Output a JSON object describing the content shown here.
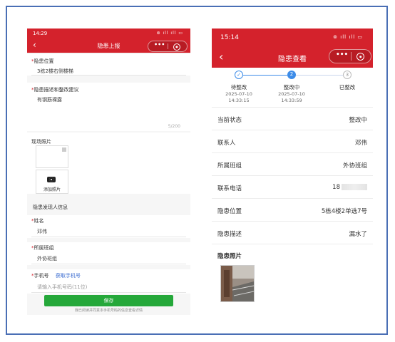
{
  "left": {
    "status_time": "14:29",
    "nav_title": "隐患上报",
    "location_label": "隐患位置",
    "location_value": "3栋2楼右侧楼梯",
    "desc_label": "隐患描述和整改建议",
    "desc_value": "有钢筋裸露",
    "desc_counter": "5/200",
    "photos_label": "现场照片",
    "add_photo": "添加照片",
    "finder_info": "隐患发现人信息",
    "name_label": "姓名",
    "name_value": "邓伟",
    "team_label": "所属班组",
    "team_value": "外协班组",
    "phone_label": "手机号",
    "get_phone": "获取手机号",
    "phone_placeholder": "请输入手机号码(11位)",
    "save_label": "保存",
    "notice_text": "我已阅读并同意本手机号码的信息查看详情",
    "notice_link": "查看详情"
  },
  "right": {
    "status_time": "15:14",
    "nav_title": "隐患查看",
    "steps": [
      {
        "label": "待整改",
        "date": "2025-07-10",
        "time": "14:33:15",
        "state": "done",
        "num": "✓"
      },
      {
        "label": "整改中",
        "date": "2025-07-10",
        "time": "14:33:59",
        "state": "active",
        "num": "2"
      },
      {
        "label": "已整改",
        "date": "",
        "time": "",
        "state": "todo",
        "num": "3"
      }
    ],
    "rows": [
      {
        "k": "当前状态",
        "v": "整改中"
      },
      {
        "k": "联系人",
        "v": "邓伟"
      },
      {
        "k": "所属班组",
        "v": "外协班组"
      },
      {
        "k": "联系电话",
        "v": "18"
      },
      {
        "k": "隐患位置",
        "v": "5栋4楼2单选7号"
      },
      {
        "k": "隐患描述",
        "v": "漏水了"
      }
    ],
    "photos_title": "隐患照片"
  },
  "colors": {
    "brand_red": "#d4222c",
    "save_green": "#25a83a",
    "step_blue": "#3d8ce8",
    "frame_blue": "#4a6fb5"
  },
  "icons": [
    "back-arrow-icon",
    "more-dots-icon",
    "target-icon",
    "camera-icon",
    "check-icon",
    "signal-icon",
    "battery-icon"
  ]
}
